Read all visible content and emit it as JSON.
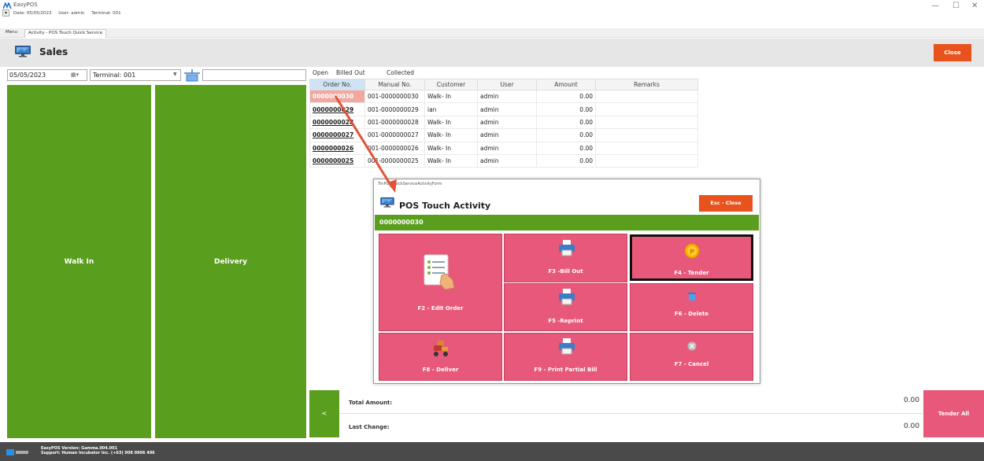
{
  "window": {
    "app_title": "EasyPOS",
    "info": {
      "date": "Date: 05/05/2023",
      "user": "User: admin",
      "terminal": "Terminal: 001"
    },
    "controls": {
      "minimize": "—",
      "restore": "☐",
      "close": "✕"
    }
  },
  "tabs": [
    {
      "label": "Menu"
    },
    {
      "label": "Activity - POS Touch Quick Service"
    }
  ],
  "header": {
    "title": "Sales",
    "close_label": "Close"
  },
  "filters": {
    "date_value": "05/05/2023",
    "terminal_value": "Terminal: 001",
    "search_value": ""
  },
  "left_buttons": {
    "walk_in": "Walk In",
    "delivery": "Delivery"
  },
  "order_tabs": [
    {
      "label": "Open"
    },
    {
      "label": "Billed Out"
    },
    {
      "label": "Collected"
    }
  ],
  "table": {
    "columns": [
      "Order No.",
      "Manual No.",
      "Customer",
      "User",
      "Amount",
      "Remarks"
    ],
    "rows": [
      {
        "order_no": "0000000030",
        "manual_no": "001-0000000030",
        "customer": "Walk- In",
        "user": "admin",
        "amount": "0.00",
        "remarks": ""
      },
      {
        "order_no": "0000000029",
        "manual_no": "001-0000000029",
        "customer": "ian",
        "user": "admin",
        "amount": "0.00",
        "remarks": ""
      },
      {
        "order_no": "0000000028",
        "manual_no": "001-0000000028",
        "customer": "Walk- In",
        "user": "admin",
        "amount": "0.00",
        "remarks": ""
      },
      {
        "order_no": "0000000027",
        "manual_no": "001-0000000027",
        "customer": "Walk- In",
        "user": "admin",
        "amount": "0.00",
        "remarks": ""
      },
      {
        "order_no": "0000000026",
        "manual_no": "001-0000000026",
        "customer": "Walk- In",
        "user": "admin",
        "amount": "0.00",
        "remarks": ""
      },
      {
        "order_no": "0000000025",
        "manual_no": "001-0000000025",
        "customer": "Walk- In",
        "user": "admin",
        "amount": "0.00",
        "remarks": ""
      }
    ]
  },
  "modal": {
    "caption": "TrnPOSQuickServiceActivityForm",
    "title": "POS Touch Activity",
    "esc_close": "Esc - Close",
    "order_no": "0000000030",
    "actions": {
      "edit_order": "F2 - Edit Order",
      "bill_out": "F3 -Bill Out",
      "tender": "F4 - Tender",
      "reprint": "F5 -Reprint",
      "delete": "F6 - Delete",
      "cancel": "F7 - Cancel",
      "deliver": "F8 - Deliver",
      "print_partial": "F9 - Print Partial Bill"
    }
  },
  "totals": {
    "back_label": "<",
    "total_amount_label": "Total Amount:",
    "total_amount_value": "0.00",
    "last_change_label": "Last Change:",
    "last_change_value": "0.00",
    "tender_all": "Tender All"
  },
  "footer": {
    "version": "EasyPOS Version: Gamma.004.001",
    "support": "Support: Human Incubator Inc. (+63) 908 0906 496"
  },
  "colors": {
    "accent_orange": "#e8521c",
    "green": "#5a9e1e",
    "tile_pink": "#e8587a",
    "footer": "#4a4a4a"
  }
}
